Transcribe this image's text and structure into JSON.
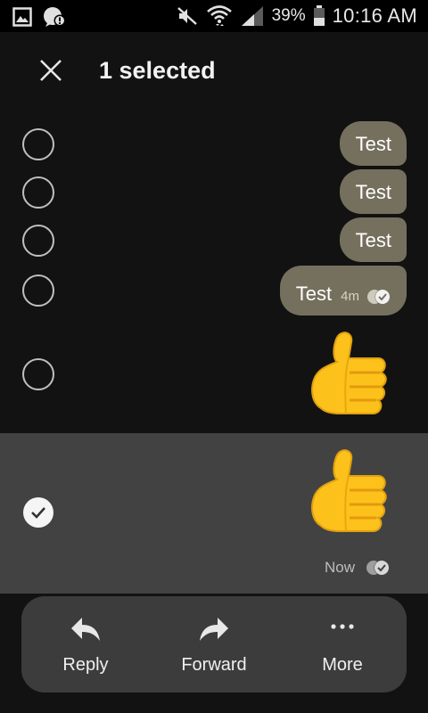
{
  "status_bar": {
    "battery": "39%",
    "time": "10:16 AM"
  },
  "header": {
    "title": "1 selected"
  },
  "messages": [
    {
      "text": "Test",
      "selected": false
    },
    {
      "text": "Test",
      "selected": false
    },
    {
      "text": "Test",
      "selected": false
    },
    {
      "text": "Test",
      "meta": "4m",
      "selected": false
    },
    {
      "type": "emoji",
      "emoji": "thumbs-up",
      "selected": false
    },
    {
      "type": "emoji",
      "emoji": "thumbs-up",
      "meta": "Now",
      "selected": true
    }
  ],
  "actions": [
    {
      "label": "Reply",
      "icon": "reply-icon"
    },
    {
      "label": "Forward",
      "icon": "forward-icon"
    },
    {
      "label": "More",
      "icon": "more-icon"
    }
  ],
  "colors": {
    "bubble": "#75705e",
    "background": "#121212",
    "selected_row": "#424242",
    "action_bar": "#3c3c3c"
  }
}
